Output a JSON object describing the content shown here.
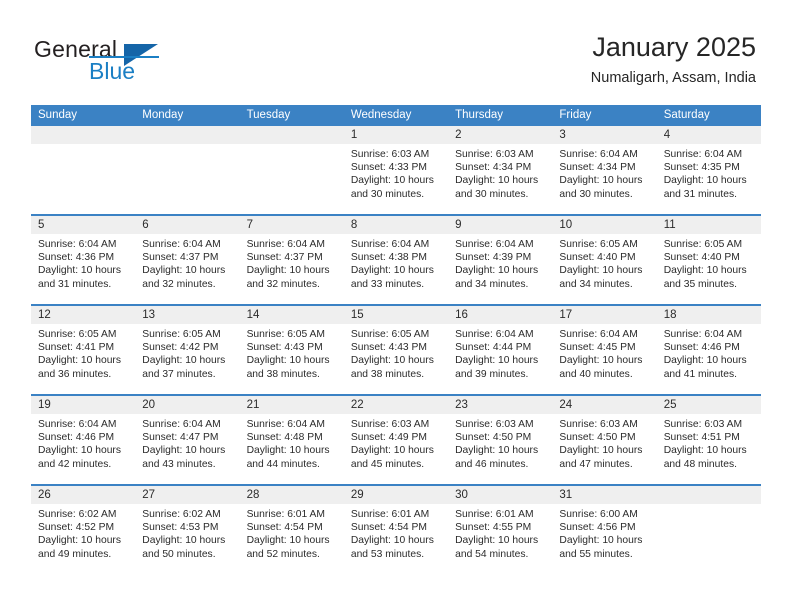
{
  "brand": {
    "name_part1": "General",
    "name_part2": "Blue"
  },
  "header": {
    "title": "January 2025",
    "subtitle": "Numaligarh, Assam, India"
  },
  "colors": {
    "header_blue": "#3b82c4",
    "logo_blue": "#1b7fc4",
    "daynum_band": "#efefef",
    "text": "#2b2b2b"
  },
  "weekdays": [
    "Sunday",
    "Monday",
    "Tuesday",
    "Wednesday",
    "Thursday",
    "Friday",
    "Saturday"
  ],
  "weeks": [
    [
      {
        "day": "",
        "sunrise": "",
        "sunset": "",
        "daylight_line1": "",
        "daylight_line2": ""
      },
      {
        "day": "",
        "sunrise": "",
        "sunset": "",
        "daylight_line1": "",
        "daylight_line2": ""
      },
      {
        "day": "",
        "sunrise": "",
        "sunset": "",
        "daylight_line1": "",
        "daylight_line2": ""
      },
      {
        "day": "1",
        "sunrise": "Sunrise: 6:03 AM",
        "sunset": "Sunset: 4:33 PM",
        "daylight_line1": "Daylight: 10 hours",
        "daylight_line2": "and 30 minutes."
      },
      {
        "day": "2",
        "sunrise": "Sunrise: 6:03 AM",
        "sunset": "Sunset: 4:34 PM",
        "daylight_line1": "Daylight: 10 hours",
        "daylight_line2": "and 30 minutes."
      },
      {
        "day": "3",
        "sunrise": "Sunrise: 6:04 AM",
        "sunset": "Sunset: 4:34 PM",
        "daylight_line1": "Daylight: 10 hours",
        "daylight_line2": "and 30 minutes."
      },
      {
        "day": "4",
        "sunrise": "Sunrise: 6:04 AM",
        "sunset": "Sunset: 4:35 PM",
        "daylight_line1": "Daylight: 10 hours",
        "daylight_line2": "and 31 minutes."
      }
    ],
    [
      {
        "day": "5",
        "sunrise": "Sunrise: 6:04 AM",
        "sunset": "Sunset: 4:36 PM",
        "daylight_line1": "Daylight: 10 hours",
        "daylight_line2": "and 31 minutes."
      },
      {
        "day": "6",
        "sunrise": "Sunrise: 6:04 AM",
        "sunset": "Sunset: 4:37 PM",
        "daylight_line1": "Daylight: 10 hours",
        "daylight_line2": "and 32 minutes."
      },
      {
        "day": "7",
        "sunrise": "Sunrise: 6:04 AM",
        "sunset": "Sunset: 4:37 PM",
        "daylight_line1": "Daylight: 10 hours",
        "daylight_line2": "and 32 minutes."
      },
      {
        "day": "8",
        "sunrise": "Sunrise: 6:04 AM",
        "sunset": "Sunset: 4:38 PM",
        "daylight_line1": "Daylight: 10 hours",
        "daylight_line2": "and 33 minutes."
      },
      {
        "day": "9",
        "sunrise": "Sunrise: 6:04 AM",
        "sunset": "Sunset: 4:39 PM",
        "daylight_line1": "Daylight: 10 hours",
        "daylight_line2": "and 34 minutes."
      },
      {
        "day": "10",
        "sunrise": "Sunrise: 6:05 AM",
        "sunset": "Sunset: 4:40 PM",
        "daylight_line1": "Daylight: 10 hours",
        "daylight_line2": "and 34 minutes."
      },
      {
        "day": "11",
        "sunrise": "Sunrise: 6:05 AM",
        "sunset": "Sunset: 4:40 PM",
        "daylight_line1": "Daylight: 10 hours",
        "daylight_line2": "and 35 minutes."
      }
    ],
    [
      {
        "day": "12",
        "sunrise": "Sunrise: 6:05 AM",
        "sunset": "Sunset: 4:41 PM",
        "daylight_line1": "Daylight: 10 hours",
        "daylight_line2": "and 36 minutes."
      },
      {
        "day": "13",
        "sunrise": "Sunrise: 6:05 AM",
        "sunset": "Sunset: 4:42 PM",
        "daylight_line1": "Daylight: 10 hours",
        "daylight_line2": "and 37 minutes."
      },
      {
        "day": "14",
        "sunrise": "Sunrise: 6:05 AM",
        "sunset": "Sunset: 4:43 PM",
        "daylight_line1": "Daylight: 10 hours",
        "daylight_line2": "and 38 minutes."
      },
      {
        "day": "15",
        "sunrise": "Sunrise: 6:05 AM",
        "sunset": "Sunset: 4:43 PM",
        "daylight_line1": "Daylight: 10 hours",
        "daylight_line2": "and 38 minutes."
      },
      {
        "day": "16",
        "sunrise": "Sunrise: 6:04 AM",
        "sunset": "Sunset: 4:44 PM",
        "daylight_line1": "Daylight: 10 hours",
        "daylight_line2": "and 39 minutes."
      },
      {
        "day": "17",
        "sunrise": "Sunrise: 6:04 AM",
        "sunset": "Sunset: 4:45 PM",
        "daylight_line1": "Daylight: 10 hours",
        "daylight_line2": "and 40 minutes."
      },
      {
        "day": "18",
        "sunrise": "Sunrise: 6:04 AM",
        "sunset": "Sunset: 4:46 PM",
        "daylight_line1": "Daylight: 10 hours",
        "daylight_line2": "and 41 minutes."
      }
    ],
    [
      {
        "day": "19",
        "sunrise": "Sunrise: 6:04 AM",
        "sunset": "Sunset: 4:46 PM",
        "daylight_line1": "Daylight: 10 hours",
        "daylight_line2": "and 42 minutes."
      },
      {
        "day": "20",
        "sunrise": "Sunrise: 6:04 AM",
        "sunset": "Sunset: 4:47 PM",
        "daylight_line1": "Daylight: 10 hours",
        "daylight_line2": "and 43 minutes."
      },
      {
        "day": "21",
        "sunrise": "Sunrise: 6:04 AM",
        "sunset": "Sunset: 4:48 PM",
        "daylight_line1": "Daylight: 10 hours",
        "daylight_line2": "and 44 minutes."
      },
      {
        "day": "22",
        "sunrise": "Sunrise: 6:03 AM",
        "sunset": "Sunset: 4:49 PM",
        "daylight_line1": "Daylight: 10 hours",
        "daylight_line2": "and 45 minutes."
      },
      {
        "day": "23",
        "sunrise": "Sunrise: 6:03 AM",
        "sunset": "Sunset: 4:50 PM",
        "daylight_line1": "Daylight: 10 hours",
        "daylight_line2": "and 46 minutes."
      },
      {
        "day": "24",
        "sunrise": "Sunrise: 6:03 AM",
        "sunset": "Sunset: 4:50 PM",
        "daylight_line1": "Daylight: 10 hours",
        "daylight_line2": "and 47 minutes."
      },
      {
        "day": "25",
        "sunrise": "Sunrise: 6:03 AM",
        "sunset": "Sunset: 4:51 PM",
        "daylight_line1": "Daylight: 10 hours",
        "daylight_line2": "and 48 minutes."
      }
    ],
    [
      {
        "day": "26",
        "sunrise": "Sunrise: 6:02 AM",
        "sunset": "Sunset: 4:52 PM",
        "daylight_line1": "Daylight: 10 hours",
        "daylight_line2": "and 49 minutes."
      },
      {
        "day": "27",
        "sunrise": "Sunrise: 6:02 AM",
        "sunset": "Sunset: 4:53 PM",
        "daylight_line1": "Daylight: 10 hours",
        "daylight_line2": "and 50 minutes."
      },
      {
        "day": "28",
        "sunrise": "Sunrise: 6:01 AM",
        "sunset": "Sunset: 4:54 PM",
        "daylight_line1": "Daylight: 10 hours",
        "daylight_line2": "and 52 minutes."
      },
      {
        "day": "29",
        "sunrise": "Sunrise: 6:01 AM",
        "sunset": "Sunset: 4:54 PM",
        "daylight_line1": "Daylight: 10 hours",
        "daylight_line2": "and 53 minutes."
      },
      {
        "day": "30",
        "sunrise": "Sunrise: 6:01 AM",
        "sunset": "Sunset: 4:55 PM",
        "daylight_line1": "Daylight: 10 hours",
        "daylight_line2": "and 54 minutes."
      },
      {
        "day": "31",
        "sunrise": "Sunrise: 6:00 AM",
        "sunset": "Sunset: 4:56 PM",
        "daylight_line1": "Daylight: 10 hours",
        "daylight_line2": "and 55 minutes."
      },
      {
        "day": "",
        "sunrise": "",
        "sunset": "",
        "daylight_line1": "",
        "daylight_line2": ""
      }
    ]
  ]
}
